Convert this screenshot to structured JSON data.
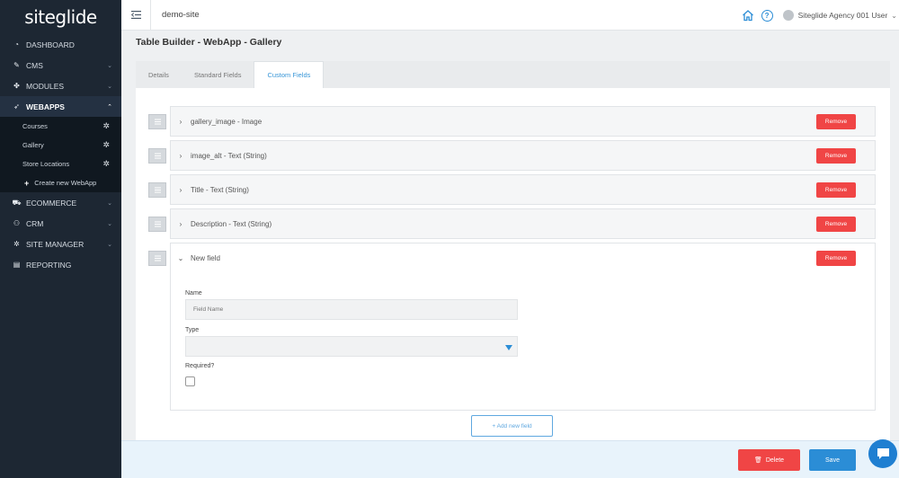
{
  "brand": {
    "logo_text": "siteglide"
  },
  "sidebar": {
    "items": [
      {
        "label": "DASHBOARD",
        "icon": "dashboard-icon"
      },
      {
        "label": "CMS",
        "icon": "edit-icon"
      },
      {
        "label": "MODULES",
        "icon": "modules-icon"
      },
      {
        "label": "WEBAPPS",
        "icon": "rocket-icon",
        "expanded": true
      },
      {
        "label": "ECOMMERCE",
        "icon": "cart-icon"
      },
      {
        "label": "CRM",
        "icon": "users-icon"
      },
      {
        "label": "SITE MANAGER",
        "icon": "gear-icon"
      },
      {
        "label": "REPORTING",
        "icon": "report-icon"
      }
    ],
    "webapps_sub": [
      {
        "label": "Courses"
      },
      {
        "label": "Gallery"
      },
      {
        "label": "Store Locations"
      }
    ],
    "create_label": "Create new WebApp"
  },
  "topbar": {
    "site_name": "demo-site",
    "user_name": "Siteglide Agency 001 User",
    "help_glyph": "?"
  },
  "page": {
    "title": "Table Builder - WebApp - Gallery",
    "tabs": [
      {
        "label": "Details"
      },
      {
        "label": "Standard Fields"
      },
      {
        "label": "Custom Fields",
        "active": true
      }
    ]
  },
  "fields": [
    {
      "label": "gallery_image - Image"
    },
    {
      "label": "image_alt - Text (String)"
    },
    {
      "label": "Title - Text (String)"
    },
    {
      "label": "Description - Text (String)"
    },
    {
      "label": "New field",
      "expanded": true
    }
  ],
  "remove_label": "Remove",
  "new_field_form": {
    "name_label": "Name",
    "name_placeholder": "Field Name",
    "type_label": "Type",
    "type_value": "",
    "required_label": "Required?",
    "required_checked": false
  },
  "add_field_label": "+ Add new field",
  "footer": {
    "delete_label": "Delete",
    "save_label": "Save"
  },
  "colors": {
    "sidebar_bg": "#1d2733",
    "accent_blue": "#2b8dd6",
    "danger_red": "#f04545"
  }
}
